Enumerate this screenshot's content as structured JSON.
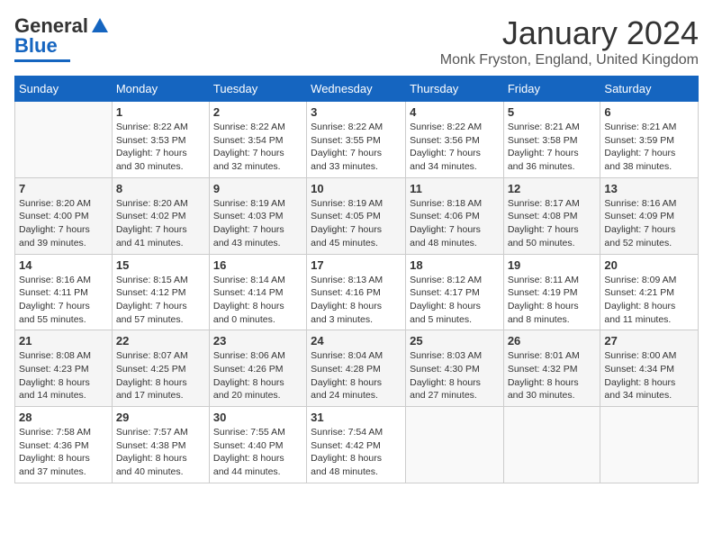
{
  "header": {
    "logo": {
      "line1": "General",
      "line2": "Blue"
    },
    "title": "January 2024",
    "location": "Monk Fryston, England, United Kingdom"
  },
  "weekdays": [
    "Sunday",
    "Monday",
    "Tuesday",
    "Wednesday",
    "Thursday",
    "Friday",
    "Saturday"
  ],
  "weeks": [
    [
      {
        "day": "",
        "info": ""
      },
      {
        "day": "1",
        "info": "Sunrise: 8:22 AM\nSunset: 3:53 PM\nDaylight: 7 hours\nand 30 minutes."
      },
      {
        "day": "2",
        "info": "Sunrise: 8:22 AM\nSunset: 3:54 PM\nDaylight: 7 hours\nand 32 minutes."
      },
      {
        "day": "3",
        "info": "Sunrise: 8:22 AM\nSunset: 3:55 PM\nDaylight: 7 hours\nand 33 minutes."
      },
      {
        "day": "4",
        "info": "Sunrise: 8:22 AM\nSunset: 3:56 PM\nDaylight: 7 hours\nand 34 minutes."
      },
      {
        "day": "5",
        "info": "Sunrise: 8:21 AM\nSunset: 3:58 PM\nDaylight: 7 hours\nand 36 minutes."
      },
      {
        "day": "6",
        "info": "Sunrise: 8:21 AM\nSunset: 3:59 PM\nDaylight: 7 hours\nand 38 minutes."
      }
    ],
    [
      {
        "day": "7",
        "info": "Sunrise: 8:20 AM\nSunset: 4:00 PM\nDaylight: 7 hours\nand 39 minutes."
      },
      {
        "day": "8",
        "info": "Sunrise: 8:20 AM\nSunset: 4:02 PM\nDaylight: 7 hours\nand 41 minutes."
      },
      {
        "day": "9",
        "info": "Sunrise: 8:19 AM\nSunset: 4:03 PM\nDaylight: 7 hours\nand 43 minutes."
      },
      {
        "day": "10",
        "info": "Sunrise: 8:19 AM\nSunset: 4:05 PM\nDaylight: 7 hours\nand 45 minutes."
      },
      {
        "day": "11",
        "info": "Sunrise: 8:18 AM\nSunset: 4:06 PM\nDaylight: 7 hours\nand 48 minutes."
      },
      {
        "day": "12",
        "info": "Sunrise: 8:17 AM\nSunset: 4:08 PM\nDaylight: 7 hours\nand 50 minutes."
      },
      {
        "day": "13",
        "info": "Sunrise: 8:16 AM\nSunset: 4:09 PM\nDaylight: 7 hours\nand 52 minutes."
      }
    ],
    [
      {
        "day": "14",
        "info": "Sunrise: 8:16 AM\nSunset: 4:11 PM\nDaylight: 7 hours\nand 55 minutes."
      },
      {
        "day": "15",
        "info": "Sunrise: 8:15 AM\nSunset: 4:12 PM\nDaylight: 7 hours\nand 57 minutes."
      },
      {
        "day": "16",
        "info": "Sunrise: 8:14 AM\nSunset: 4:14 PM\nDaylight: 8 hours\nand 0 minutes."
      },
      {
        "day": "17",
        "info": "Sunrise: 8:13 AM\nSunset: 4:16 PM\nDaylight: 8 hours\nand 3 minutes."
      },
      {
        "day": "18",
        "info": "Sunrise: 8:12 AM\nSunset: 4:17 PM\nDaylight: 8 hours\nand 5 minutes."
      },
      {
        "day": "19",
        "info": "Sunrise: 8:11 AM\nSunset: 4:19 PM\nDaylight: 8 hours\nand 8 minutes."
      },
      {
        "day": "20",
        "info": "Sunrise: 8:09 AM\nSunset: 4:21 PM\nDaylight: 8 hours\nand 11 minutes."
      }
    ],
    [
      {
        "day": "21",
        "info": "Sunrise: 8:08 AM\nSunset: 4:23 PM\nDaylight: 8 hours\nand 14 minutes."
      },
      {
        "day": "22",
        "info": "Sunrise: 8:07 AM\nSunset: 4:25 PM\nDaylight: 8 hours\nand 17 minutes."
      },
      {
        "day": "23",
        "info": "Sunrise: 8:06 AM\nSunset: 4:26 PM\nDaylight: 8 hours\nand 20 minutes."
      },
      {
        "day": "24",
        "info": "Sunrise: 8:04 AM\nSunset: 4:28 PM\nDaylight: 8 hours\nand 24 minutes."
      },
      {
        "day": "25",
        "info": "Sunrise: 8:03 AM\nSunset: 4:30 PM\nDaylight: 8 hours\nand 27 minutes."
      },
      {
        "day": "26",
        "info": "Sunrise: 8:01 AM\nSunset: 4:32 PM\nDaylight: 8 hours\nand 30 minutes."
      },
      {
        "day": "27",
        "info": "Sunrise: 8:00 AM\nSunset: 4:34 PM\nDaylight: 8 hours\nand 34 minutes."
      }
    ],
    [
      {
        "day": "28",
        "info": "Sunrise: 7:58 AM\nSunset: 4:36 PM\nDaylight: 8 hours\nand 37 minutes."
      },
      {
        "day": "29",
        "info": "Sunrise: 7:57 AM\nSunset: 4:38 PM\nDaylight: 8 hours\nand 40 minutes."
      },
      {
        "day": "30",
        "info": "Sunrise: 7:55 AM\nSunset: 4:40 PM\nDaylight: 8 hours\nand 44 minutes."
      },
      {
        "day": "31",
        "info": "Sunrise: 7:54 AM\nSunset: 4:42 PM\nDaylight: 8 hours\nand 48 minutes."
      },
      {
        "day": "",
        "info": ""
      },
      {
        "day": "",
        "info": ""
      },
      {
        "day": "",
        "info": ""
      }
    ]
  ]
}
